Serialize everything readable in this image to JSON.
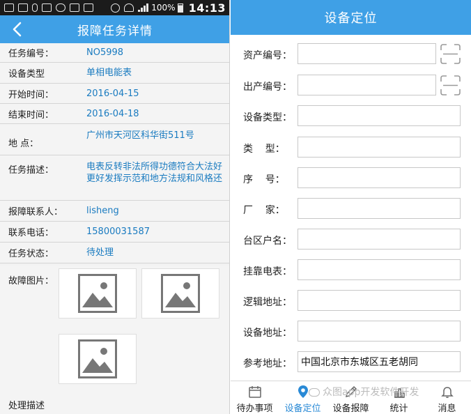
{
  "left": {
    "statusbar": {
      "battery": "100%",
      "time": "14:13"
    },
    "title": "报障任务详情",
    "fields": [
      {
        "label": "任务编号：",
        "value": "NO5998"
      },
      {
        "label": "设备类型",
        "value": "单相电能表"
      },
      {
        "label": "开始时间：",
        "value": "2016-04-15"
      },
      {
        "label": "结束时间：",
        "value": "2016-04-18"
      },
      {
        "label": "地  点：",
        "value": "广州市天河区科华街511号"
      },
      {
        "label": "任务描述：",
        "value": "电表反转非法所得功德符合大法好更好发挥示范和地方法规和风格还"
      },
      {
        "label": "报障联系人：",
        "value": "lisheng"
      },
      {
        "label": "联系电话：",
        "value": "15800031587"
      },
      {
        "label": "任务状态：",
        "value": "待处理"
      }
    ],
    "pictures_label": "故障图片：",
    "handle_desc_label": "处理描述"
  },
  "right": {
    "title": "设备定位",
    "fields": [
      {
        "label": "资产编号：",
        "value": ""
      },
      {
        "label": "出产编号：",
        "value": ""
      },
      {
        "label": "设备类型：",
        "value": ""
      },
      {
        "label": "类    型：",
        "value": ""
      },
      {
        "label": "序    号：",
        "value": ""
      },
      {
        "label": "厂    家：",
        "value": ""
      },
      {
        "label": "台区户名：",
        "value": ""
      },
      {
        "label": "挂靠电表：",
        "value": ""
      },
      {
        "label": "逻辑地址：",
        "value": ""
      },
      {
        "label": "设备地址：",
        "value": ""
      },
      {
        "label": "参考地址：",
        "value": "中国北京市东城区五老胡同"
      }
    ],
    "tabs": [
      {
        "label": "待办事项",
        "icon": "calendar-icon"
      },
      {
        "label": "设备定位",
        "icon": "location-pin-icon"
      },
      {
        "label": "设备报障",
        "icon": "edit-icon"
      },
      {
        "label": "统计",
        "icon": "chart-icon"
      },
      {
        "label": "消息",
        "icon": "bell-icon"
      }
    ],
    "active_tab": "设备定位",
    "watermark": "众图app开发软件开发"
  },
  "colors": {
    "header_blue": "#3fa0e6",
    "value_blue": "#1a7bc0",
    "active_tab": "#2a8ad6"
  }
}
